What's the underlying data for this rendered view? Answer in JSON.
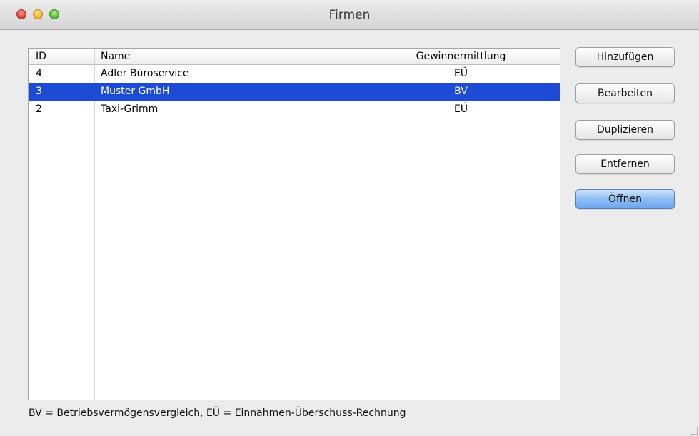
{
  "window": {
    "title": "Firmen"
  },
  "table": {
    "columns": [
      "ID",
      "Name",
      "Gewinnermittlung"
    ],
    "rows": [
      {
        "id": "4",
        "name": "Adler Büroservice",
        "gewinnermittlung": "EÜ",
        "selected": false
      },
      {
        "id": "3",
        "name": "Muster GmbH",
        "gewinnermittlung": "BV",
        "selected": true
      },
      {
        "id": "2",
        "name": "Taxi-Grimm",
        "gewinnermittlung": "EÜ",
        "selected": false
      }
    ]
  },
  "buttons": {
    "add": "Hinzufügen",
    "edit": "Bearbeiten",
    "duplicate": "Duplizieren",
    "remove": "Entfernen",
    "open": "Öffnen"
  },
  "legend": "BV = Betriebsvermögensvergleich, EÜ = Einnahmen-Überschuss-Rechnung",
  "colors": {
    "selection": "#1d4bd6",
    "primary_button": "#8fbdf4"
  }
}
